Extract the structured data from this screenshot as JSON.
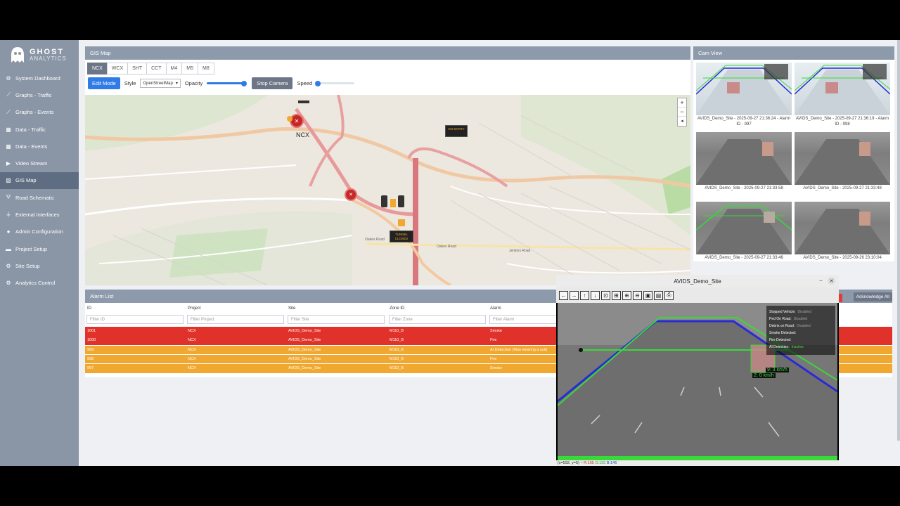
{
  "brand": {
    "name": "GHOST",
    "sub": "ANALYTICS"
  },
  "nav": [
    {
      "label": "System Dashboard",
      "icon": "gear-icon",
      "glyph": "⚙"
    },
    {
      "label": "Graphs - Traffic",
      "icon": "chart-icon",
      "glyph": "⟋"
    },
    {
      "label": "Graphs - Events",
      "icon": "chart-icon",
      "glyph": "⟋"
    },
    {
      "label": "Data - Traffic",
      "icon": "table-icon",
      "glyph": "▦"
    },
    {
      "label": "Data - Events",
      "icon": "table-icon",
      "glyph": "▦"
    },
    {
      "label": "Video Stream",
      "icon": "video-icon",
      "glyph": "▶"
    },
    {
      "label": "GIS Map",
      "icon": "map-icon",
      "glyph": "▨"
    },
    {
      "label": "Road Schematic",
      "icon": "road-icon",
      "glyph": "⛛"
    },
    {
      "label": "External Interfaces",
      "icon": "plug-icon",
      "glyph": "⏚"
    },
    {
      "label": "Admin Configuration",
      "icon": "user-icon",
      "glyph": "●"
    },
    {
      "label": "Project Setup",
      "icon": "folder-icon",
      "glyph": "▬"
    },
    {
      "label": "Site Setup",
      "icon": "gear-icon",
      "glyph": "⚙"
    },
    {
      "label": "Analytics Control",
      "icon": "gear-icon",
      "glyph": "⚙"
    }
  ],
  "gis": {
    "title": "GIS Map",
    "tabs": [
      "NCX",
      "WCX",
      "SHT",
      "CCT",
      "M4",
      "M5",
      "M8"
    ],
    "edit_mode": "Edit Mode",
    "style_label": "Style",
    "style_value": "OpenStreetMap",
    "opacity_label": "Opacity",
    "opacity_level": 1.0,
    "stop_camera": "Stop Camera",
    "speed_label": "Speed",
    "speed_level": 0.0,
    "marker_label": "NCX",
    "signs": [
      "NO ENTRY",
      "TUNNEL CLOSED"
    ],
    "streets": [
      "Oakes Road",
      "Oakes Road",
      "Jenkins Road"
    ],
    "zoom_in": "+",
    "zoom_out": "−"
  },
  "cam": {
    "title": "Cam View",
    "thumbs": [
      "AVIDS_Demo_Site - 2025-09-27 21:36:24 - Alarm ID - 997",
      "AVIDS_Demo_Site - 2025-09-27 21:36:19 - Alarm ID - 998",
      "AVIDS_Demo_Site - 2025-09-27 21:33:58",
      "AVIDS_Demo_Site - 2025-09-27 21:33:48",
      "AVIDS_Demo_Site - 2025-09-27 21:33:46",
      "AVIDS_Demo_Site - 2025-09-26 23:10:04"
    ]
  },
  "alarms": {
    "title": "Alarm List",
    "ack_all": "Acknowledge All",
    "columns": [
      "ID",
      "Project",
      "Site",
      "Zone ID",
      "Alarm"
    ],
    "filters": [
      "Filter ID",
      "Filter Project",
      "Filter Site",
      "Filter Zone",
      "Filter Alarm"
    ],
    "rows": [
      {
        "id": "1001",
        "project": "NCX",
        "site": "AVIDS_Demo_Site",
        "zone": "M110_B",
        "alarm": "Smoke",
        "color": "#e0322a"
      },
      {
        "id": "1000",
        "project": "NCX",
        "site": "AVIDS_Demo_Site",
        "zone": "M110_B",
        "alarm": "Fire",
        "color": "#e0322a"
      },
      {
        "id": "999",
        "project": "NCX",
        "site": "AVIDS_Demo_Site",
        "zone": "M110_B",
        "alarm": "AI Detection (Man wearing a suit)",
        "color": "#f0a830"
      },
      {
        "id": "998",
        "project": "NCX",
        "site": "AVIDS_Demo_Site",
        "zone": "M110_B",
        "alarm": "Fire",
        "color": "#f0a830"
      },
      {
        "id": "997",
        "project": "NCX",
        "site": "AVIDS_Demo_Site",
        "zone": "M110_B",
        "alarm": "Smoke",
        "color": "#f0a830"
      }
    ]
  },
  "viewer": {
    "title": "AVIDS_Demo_Site",
    "tools": [
      "←",
      "→",
      "↑",
      "↓",
      "⊡",
      "⊞",
      "⊕",
      "⊖",
      "▣",
      "▤",
      "⎙"
    ],
    "status_prefix": "(x=592, y=5) ~ ",
    "status_r": "R:165",
    "status_g": "G:155",
    "status_b": "B:146",
    "overlay": [
      {
        "label": "Stopped Vehicle:",
        "value": "Disabled",
        "color": "#9aa0a6"
      },
      {
        "label": "Ped On Road:",
        "value": "Disabled",
        "color": "#9aa0a6"
      },
      {
        "label": "Debris on Road:",
        "value": "Disabled",
        "color": "#9aa0a6"
      },
      {
        "label": "Smoke Detected:",
        "value": "",
        "color": "#ffffff"
      },
      {
        "label": "Fire Detected:",
        "value": "",
        "color": "#ffffff"
      },
      {
        "label": "AI Detection:",
        "value": "Inactive",
        "color": "#3ddc3d"
      }
    ],
    "speed_tags": [
      "9: 3 km/h",
      "2: 0 km/h"
    ]
  }
}
